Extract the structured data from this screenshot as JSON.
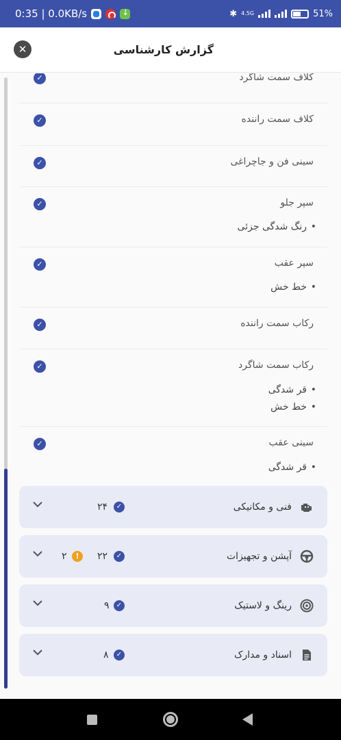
{
  "status_bar": {
    "time_speed": "0:35 | 0.0KB/s",
    "network": "4.5G",
    "battery": "51%"
  },
  "header": {
    "title": "گزارش کارشناسی"
  },
  "items": [
    {
      "name": "کلاف سمت شاگرد",
      "notes": []
    },
    {
      "name": "کلاف سمت راننده",
      "notes": []
    },
    {
      "name": "سینی فن و جاچراغی",
      "notes": []
    },
    {
      "name": "سپر جلو",
      "notes": [
        "رنگ شدگی جزئی"
      ]
    },
    {
      "name": "سپر عقب",
      "notes": [
        "خط خش"
      ]
    },
    {
      "name": "رکاب سمت راننده",
      "notes": []
    },
    {
      "name": "رکاب سمت شاگرد",
      "notes": [
        "قر شدگی",
        "خط خش"
      ]
    },
    {
      "name": "سینی عقب",
      "notes": [
        "قر شدگی"
      ]
    }
  ],
  "categories": [
    {
      "name": "فنی و مکانیکی",
      "icon": "engine-icon",
      "ok_count": "۲۴",
      "warn_count": ""
    },
    {
      "name": "آپشن و تجهیزات",
      "icon": "steering-wheel-icon",
      "ok_count": "۲۲",
      "warn_count": "۲"
    },
    {
      "name": "رینگ و لاستیک",
      "icon": "tire-icon",
      "ok_count": "۹",
      "warn_count": ""
    },
    {
      "name": "اسناد و مدارک",
      "icon": "document-icon",
      "ok_count": "۸",
      "warn_count": ""
    }
  ],
  "colors": {
    "primary": "#3c51a8",
    "card_bg": "#e8eaf6",
    "warning": "#f0a020"
  }
}
